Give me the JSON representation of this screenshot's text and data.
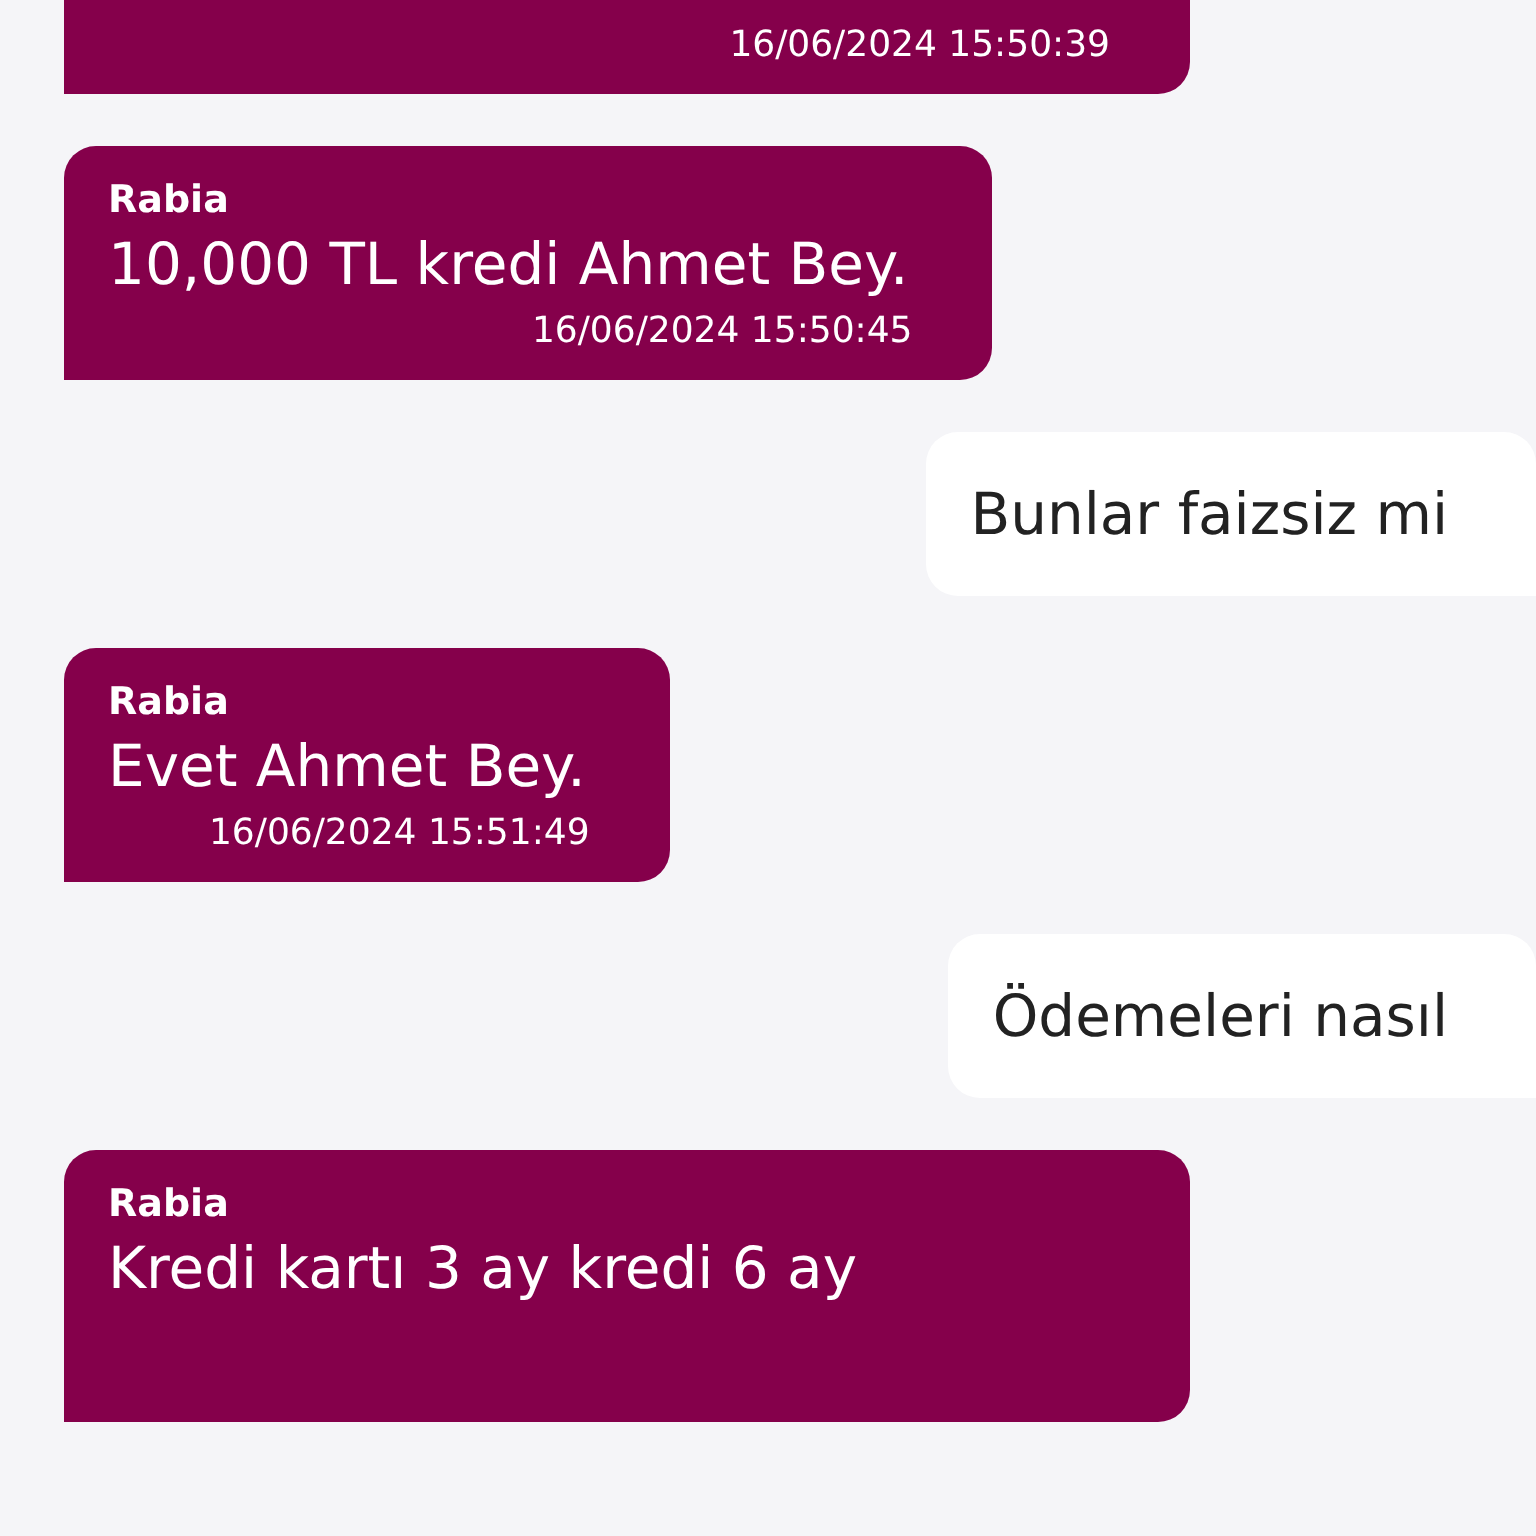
{
  "messages": [
    {
      "kind": "received",
      "time": "16/06/2024 15:50:39"
    },
    {
      "kind": "received",
      "sender": "Rabia",
      "text": "10,000 TL kredi Ahmet Bey.",
      "time": "16/06/2024 15:50:45"
    },
    {
      "kind": "sent",
      "text": "Bunlar faizsiz mi"
    },
    {
      "kind": "received",
      "sender": "Rabia",
      "text": "Evet Ahmet Bey.",
      "time": "16/06/2024 15:51:49"
    },
    {
      "kind": "sent",
      "text": "Ödemeleri nasıl"
    },
    {
      "kind": "received",
      "sender": "Rabia",
      "text": "Kredi kartı 3 ay kredi 6 ay"
    }
  ]
}
